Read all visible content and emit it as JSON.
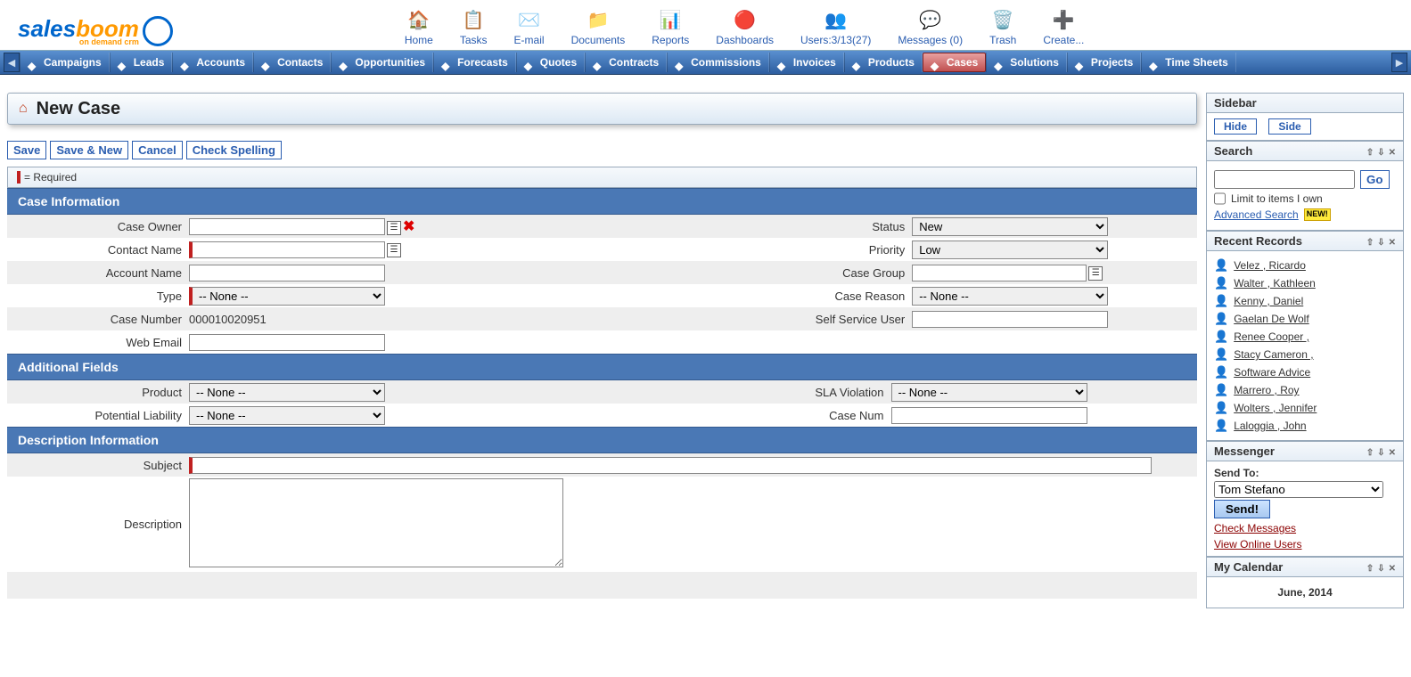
{
  "logo": {
    "part1": "sales",
    "part2": "boom",
    "subtitle": "on demand crm"
  },
  "topnav": {
    "home": "Home",
    "tasks": "Tasks",
    "email": "E-mail",
    "documents": "Documents",
    "reports": "Reports",
    "dashboards": "Dashboards",
    "users": "Users:3/13(27)",
    "messages": "Messages (0)",
    "trash": "Trash",
    "create": "Create..."
  },
  "menubar": [
    "Campaigns",
    "Leads",
    "Accounts",
    "Contacts",
    "Opportunities",
    "Forecasts",
    "Quotes",
    "Contracts",
    "Commissions",
    "Invoices",
    "Products",
    "Cases",
    "Solutions",
    "Projects",
    "Time Sheets"
  ],
  "menubar_active": "Cases",
  "page_title": "New Case",
  "actions": {
    "save": "Save",
    "save_new": "Save & New",
    "cancel": "Cancel",
    "spell": "Check Spelling"
  },
  "required_hint": "= Required",
  "sections": {
    "case_info": "Case Information",
    "additional": "Additional Fields",
    "desc_info": "Description Information"
  },
  "fields": {
    "case_owner_label": "Case Owner",
    "case_owner_value": "",
    "contact_name_label": "Contact Name",
    "contact_name_value": "",
    "account_name_label": "Account Name",
    "account_name_value": "",
    "type_label": "Type",
    "type_value": "-- None --",
    "case_number_label": "Case Number",
    "case_number_value": "000010020951",
    "web_email_label": "Web Email",
    "web_email_value": "",
    "status_label": "Status",
    "status_value": "New",
    "priority_label": "Priority",
    "priority_value": "Low",
    "case_group_label": "Case Group",
    "case_group_value": "",
    "case_reason_label": "Case Reason",
    "case_reason_value": "-- None --",
    "self_service_label": "Self Service User",
    "self_service_value": "",
    "product_label": "Product",
    "product_value": "-- None --",
    "potential_liability_label": "Potential Liability",
    "potential_liability_value": "-- None --",
    "sla_label": "SLA Violation",
    "sla_value": "-- None --",
    "case_num2_label": "Case Num",
    "case_num2_value": "",
    "subject_label": "Subject",
    "subject_value": "",
    "description_label": "Description",
    "description_value": ""
  },
  "sidebar": {
    "title": "Sidebar",
    "hide": "Hide",
    "side": "Side",
    "search": {
      "title": "Search",
      "go": "Go",
      "limit": "Limit to items I own",
      "adv": "Advanced Search",
      "new": "NEW!"
    },
    "recent": {
      "title": "Recent Records",
      "items": [
        "Velez , Ricardo",
        "Walter , Kathleen",
        "Kenny , Daniel",
        "Gaelan De Wolf",
        "Renee Cooper ,",
        "Stacy Cameron ,",
        "Software Advice",
        "Marrero , Roy",
        "Wolters , Jennifer",
        "Laloggia , John"
      ]
    },
    "messenger": {
      "title": "Messenger",
      "sendto_label": "Send To:",
      "sendto_value": "Tom Stefano",
      "send": "Send!",
      "check": "Check Messages",
      "online": "View Online Users"
    },
    "calendar": {
      "title": "My Calendar",
      "month": "June, 2014"
    }
  }
}
